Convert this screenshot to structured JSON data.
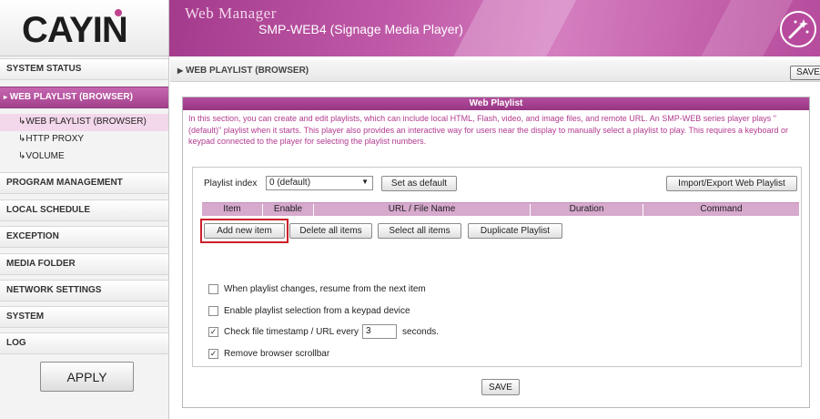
{
  "header": {
    "logo": "CAYIN",
    "title": "Web Manager",
    "subtitle": "SMP-WEB4 (Signage Media Player)"
  },
  "sidebar": {
    "items": [
      {
        "label": "SYSTEM STATUS"
      },
      {
        "label": "WEB PLAYLIST (BROWSER)",
        "active": true
      },
      {
        "label": "PROGRAM MANAGEMENT"
      },
      {
        "label": "LOCAL SCHEDULE"
      },
      {
        "label": "EXCEPTION"
      },
      {
        "label": "MEDIA FOLDER"
      },
      {
        "label": "NETWORK SETTINGS"
      },
      {
        "label": "SYSTEM"
      },
      {
        "label": "LOG"
      }
    ],
    "subitems": [
      {
        "label": "WEB PLAYLIST (BROWSER)"
      },
      {
        "label": "HTTP PROXY"
      },
      {
        "label": "VOLUME"
      }
    ],
    "apply_label": "APPLY"
  },
  "breadcrumb": "WEB PLAYLIST (BROWSER)",
  "save_label": "SAVE",
  "panel": {
    "title": "Web Playlist",
    "description": "In this section, you can create and edit playlists, which can include local HTML, Flash, video, and image files, and remote URL. An SMP-WEB series player plays \"(default)\" playlist when it starts. This player also provides an interactive way for users near the display to manually select a playlist to play. This requires a keyboard or keypad connected to the player for selecting the playlist numbers.",
    "playlist_index_label": "Playlist index",
    "playlist_index_value": "0 (default)",
    "set_default_label": "Set as default",
    "import_export_label": "Import/Export Web Playlist",
    "columns": [
      "Item",
      "Enable",
      "URL / File Name",
      "Duration",
      "Command"
    ],
    "actions": [
      "Add new item",
      "Delete all items",
      "Select all items",
      "Duplicate Playlist"
    ],
    "options": [
      {
        "label": "When playlist changes, resume from the next item",
        "checked": false
      },
      {
        "label": "Enable playlist selection from a keypad device",
        "checked": false
      },
      {
        "label": "Check file timestamp / URL every",
        "checked": true,
        "value": "3",
        "suffix": "seconds."
      },
      {
        "label": "Remove browser scrollbar",
        "checked": true
      }
    ]
  },
  "colors": {
    "accent": "#a3408c",
    "header_bar": "#d6a9cd",
    "highlight": "#cc1f2a",
    "description_text": "#b23a8f"
  }
}
